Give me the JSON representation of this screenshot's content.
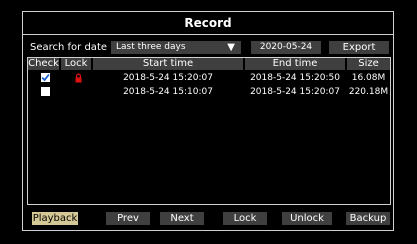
{
  "window": {
    "title": "Record"
  },
  "search": {
    "label": "Search for date",
    "range_selected": "Last three days",
    "date": "2020-05-24",
    "export_label": "Export"
  },
  "table": {
    "headers": {
      "check": "Check",
      "lock": "Lock",
      "start": "Start time",
      "end": "End time",
      "size": "Size"
    },
    "rows": [
      {
        "checked": true,
        "locked": true,
        "start": "2018-5-24  15:20:07",
        "end": "2018-5-24  15:20:50",
        "size": "16.08M"
      },
      {
        "checked": false,
        "locked": false,
        "start": "2018-5-24  15:10:07",
        "end": "2018-5-24  15:20:07",
        "size": "220.18M"
      }
    ]
  },
  "toolbar": {
    "playback": "Playback",
    "prev": "Prev",
    "next": "Next",
    "lock": "Lock",
    "unlock": "Unlock",
    "backup": "Backup"
  },
  "colors": {
    "button_bg": "#3f3f3f",
    "active_button": "#d4c996",
    "lock_red": "#e01010",
    "check_blue": "#1a5fd0"
  },
  "icons": {
    "dropdown": "triangle-down-icon",
    "lock": "padlock-icon",
    "check": "checkmark-icon"
  }
}
